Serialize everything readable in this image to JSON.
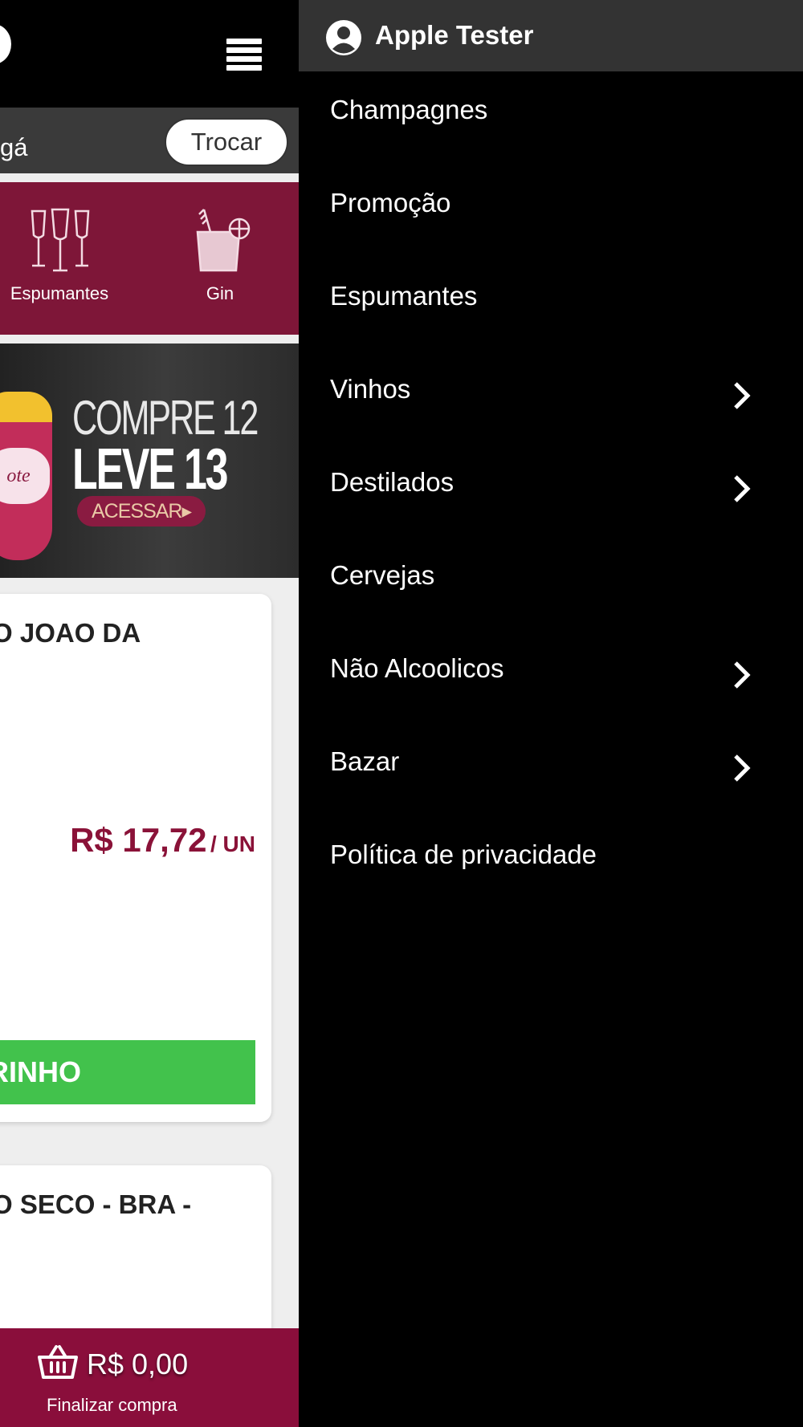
{
  "app": {
    "city_partial": "gá",
    "change_city_label": "Trocar"
  },
  "categories": [
    {
      "label": "Espumantes",
      "icon": "champagne-glasses-icon"
    },
    {
      "label": "Gin",
      "icon": "gin-cocktail-icon"
    }
  ],
  "banner": {
    "line1": "COMPRE 12",
    "line2": "LEVE 13",
    "cta": "ACESSAR▸",
    "bottle_label": "ote"
  },
  "products": [
    {
      "title_partial": "O JOAO DA",
      "price": "R$ 17,72",
      "unit": "/ UN",
      "button_partial": "RINHO"
    },
    {
      "title_partial": "O SECO - BRA -"
    }
  ],
  "cart": {
    "total": "R$ 0,00",
    "checkout_label": "Finalizar compra"
  },
  "drawer": {
    "user_name": "Apple Tester",
    "items": [
      {
        "label": "Champagnes",
        "has_submenu": false
      },
      {
        "label": "Promoção",
        "has_submenu": false
      },
      {
        "label": "Espumantes",
        "has_submenu": false
      },
      {
        "label": "Vinhos",
        "has_submenu": true
      },
      {
        "label": "Destilados",
        "has_submenu": true
      },
      {
        "label": "Cervejas",
        "has_submenu": false
      },
      {
        "label": "Não Alcoolicos",
        "has_submenu": true
      },
      {
        "label": "Bazar",
        "has_submenu": true
      },
      {
        "label": "Política de privacidade",
        "has_submenu": false
      }
    ]
  },
  "colors": {
    "brand": "#7e1638",
    "price": "#8a1238",
    "add_button": "#42c24c",
    "drawer_bg": "#000000",
    "drawer_header": "#333333"
  }
}
